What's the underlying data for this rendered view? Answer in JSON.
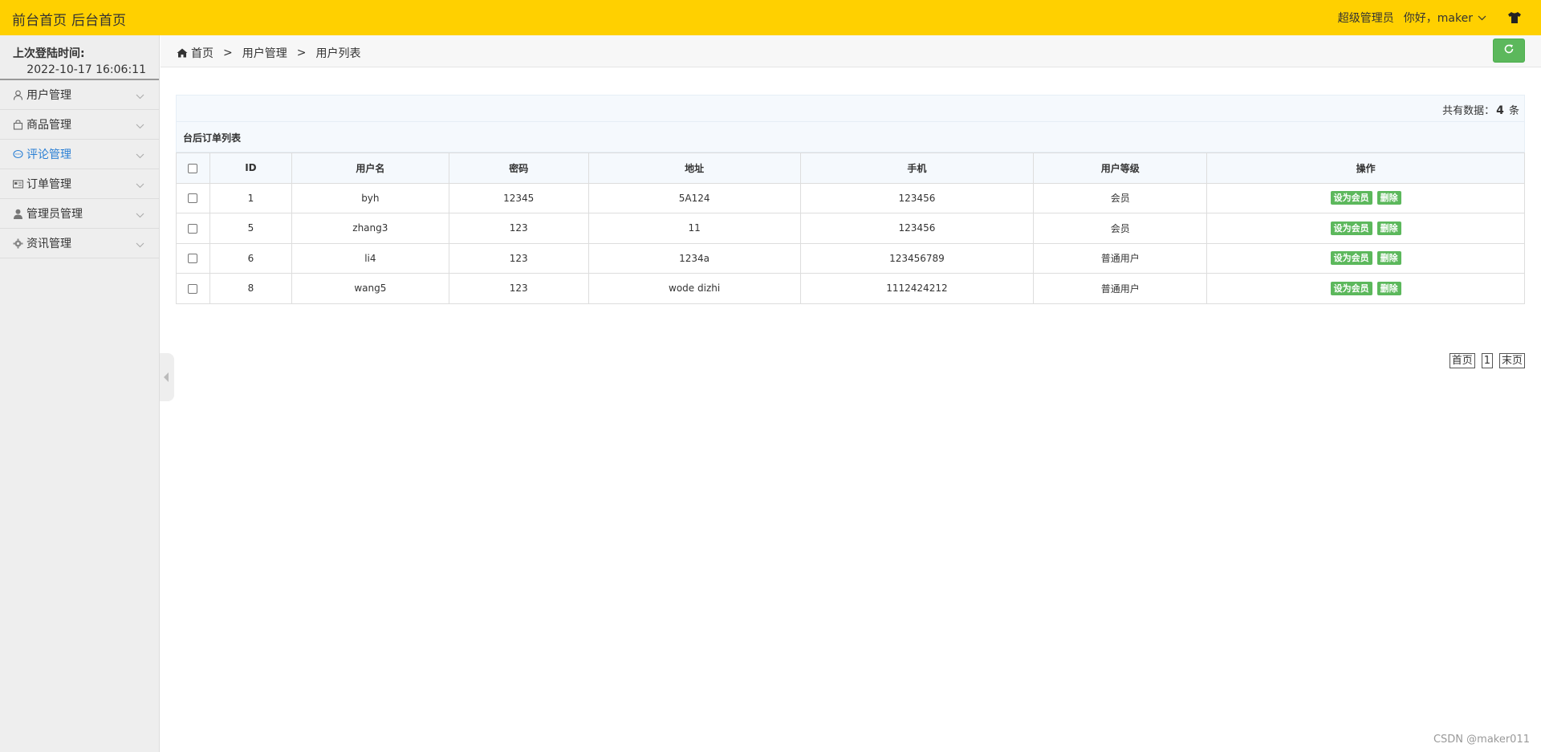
{
  "topbar": {
    "front_home": "前台首页",
    "back_home": "后台首页",
    "role": "超级管理员",
    "greeting": "你好，maker",
    "bg_color": "#ffd000"
  },
  "sidebar": {
    "last_login_label": "上次登陆时间:",
    "last_login_time": "2022-10-17 16:06:11",
    "items": [
      {
        "label": "用户管理",
        "icon": "user-outline-icon"
      },
      {
        "label": "商品管理",
        "icon": "shopping-bag-icon"
      },
      {
        "label": "评论管理",
        "icon": "comment-icon",
        "active": true
      },
      {
        "label": "订单管理",
        "icon": "order-card-icon"
      },
      {
        "label": "管理员管理",
        "icon": "admin-user-icon"
      },
      {
        "label": "资讯管理",
        "icon": "gear-icon"
      }
    ]
  },
  "breadcrumb": {
    "home": "首页",
    "sep": ">",
    "level1": "用户管理",
    "level2": "用户列表"
  },
  "content": {
    "total_prefix": "共有数据：",
    "total_count": "4",
    "total_suffix": "条",
    "table_title": "台后订单列表",
    "columns": [
      "ID",
      "用户名",
      "密码",
      "地址",
      "手机",
      "用户等级",
      "操作"
    ],
    "rows": [
      {
        "id": "1",
        "username": "byh",
        "password": "12345",
        "address": "5A124",
        "phone": "123456",
        "level": "会员"
      },
      {
        "id": "5",
        "username": "zhang3",
        "password": "123",
        "address": "11",
        "phone": "123456",
        "level": "会员"
      },
      {
        "id": "6",
        "username": "li4",
        "password": "123",
        "address": "1234a",
        "phone": "123456789",
        "level": "普通用户"
      },
      {
        "id": "8",
        "username": "wang5",
        "password": "123",
        "address": "wode dizhi",
        "phone": "1112424212",
        "level": "普通用户"
      }
    ],
    "action_set_member": "设为会员",
    "action_delete": "删除",
    "accent_color": "#5cb85c"
  },
  "pager": {
    "first": "首页",
    "page": "1",
    "last": "末页"
  },
  "watermark": "CSDN @maker011"
}
